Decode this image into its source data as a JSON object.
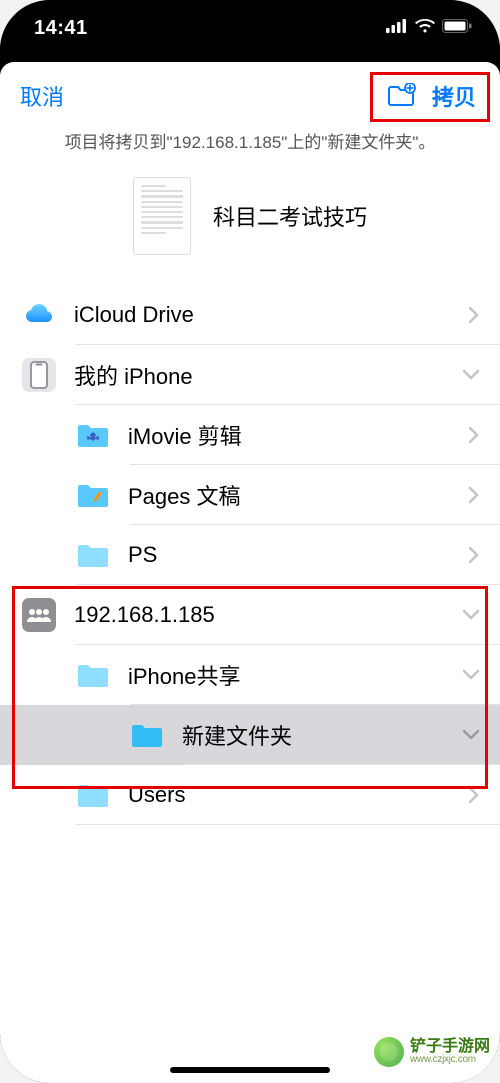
{
  "status_bar": {
    "time": "14:41"
  },
  "nav": {
    "cancel": "取消",
    "copy": "拷贝"
  },
  "subtitle": "项目将拷贝到\"192.168.1.185\"上的\"新建文件夹\"。",
  "preview": {
    "title": "科目二考试技巧"
  },
  "locations": {
    "icloud": "iCloud Drive",
    "myiphone": "我的 iPhone",
    "imovie": "iMovie 剪辑",
    "pages": "Pages 文稿",
    "ps": "PS",
    "server": "192.168.1.185",
    "iphone_share": "iPhone共享",
    "new_folder": "新建文件夹",
    "users": "Users"
  },
  "watermark": {
    "cn": "铲子手游网",
    "en": "www.czjxjc.com"
  }
}
